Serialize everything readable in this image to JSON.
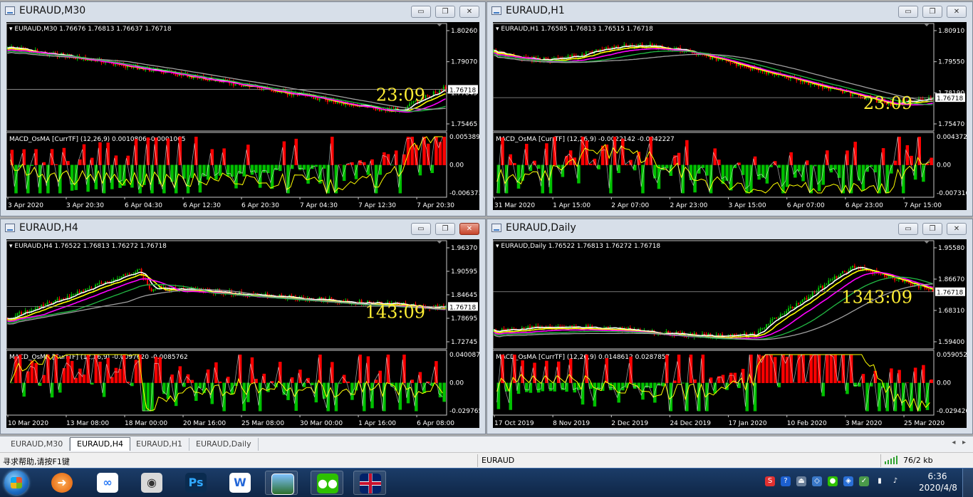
{
  "windows": [
    {
      "id": "m30",
      "title": "EURAUD,M30",
      "header": "EURAUD,M30  1.76676 1.76813 1.76637 1.76718",
      "price_ticks": [
        "1.80260",
        "1.79070",
        "1.77845",
        "1.75465"
      ],
      "current_price": "1.76718",
      "countdown": "23:09",
      "macd_header": "MACD_OsMA [CurrTF] (12,26,9) 0.0010806 -0.0001065",
      "macd_ticks": [
        "0.0053894",
        "0.00",
        "-0.006373"
      ],
      "time_labels": [
        "3 Apr 2020",
        "3 Apr 20:30",
        "6 Apr 04:30",
        "6 Apr 12:30",
        "6 Apr 20:30",
        "7 Apr 04:30",
        "7 Apr 12:30",
        "7 Apr 20:30"
      ]
    },
    {
      "id": "h1",
      "title": "EURAUD,H1",
      "header": "EURAUD,H1  1.76585 1.76813 1.76515 1.76718",
      "price_ticks": [
        "1.80910",
        "1.79550",
        "1.78190",
        "1.75470"
      ],
      "current_price": "1.76718",
      "countdown": "23:09",
      "macd_header": "MACD_OsMA [CurrTF] (12,26,9) -0.0022142 -0.0042227",
      "macd_ticks": [
        "0.0043724",
        "0.00",
        "-0.007316"
      ],
      "time_labels": [
        "31 Mar 2020",
        "1 Apr 15:00",
        "2 Apr 07:00",
        "2 Apr 23:00",
        "3 Apr 15:00",
        "6 Apr 07:00",
        "6 Apr 23:00",
        "7 Apr 15:00"
      ]
    },
    {
      "id": "h4",
      "title": "EURAUD,H4",
      "header": "EURAUD,H4  1.76522 1.76813 1.76272 1.76718",
      "price_ticks": [
        "1.96370",
        "1.90595",
        "1.84645",
        "1.78695",
        "1.72745"
      ],
      "current_price": "1.76718",
      "countdown": "143:09",
      "macd_header": "MACD_OsMA [CurrTF] (12,26,9) -0.0097620 -0.0085762",
      "macd_ticks": [
        "0.0400879",
        "0.00",
        "-0.029765"
      ],
      "time_labels": [
        "10 Mar 2020",
        "13 Mar 08:00",
        "18 Mar 00:00",
        "20 Mar 16:00",
        "25 Mar 08:00",
        "30 Mar 00:00",
        "1 Apr 16:00",
        "6 Apr 08:00"
      ]
    },
    {
      "id": "d1",
      "title": "EURAUD,Daily",
      "header": "EURAUD,Daily  1.76522 1.76813 1.76272 1.76718",
      "price_ticks": [
        "1.95580",
        "1.86670",
        "1.68310",
        "1.59400"
      ],
      "current_price": "1.76718",
      "countdown": "1343:09",
      "macd_header": "MACD_OsMA [CurrTF] (12,26,9) 0.0148612 0.0287857",
      "macd_ticks": [
        "0.0590525",
        "0.00",
        "-0.029420"
      ],
      "time_labels": [
        "17 Oct 2019",
        "8 Nov 2019",
        "2 Dec 2019",
        "24 Dec 2019",
        "17 Jan 2020",
        "10 Feb 2020",
        "3 Mar 2020",
        "25 Mar 2020"
      ]
    }
  ],
  "tabs": [
    "EURAUD,M30",
    "EURAUD,H4",
    "EURAUD,H1",
    "EURAUD,Daily"
  ],
  "active_tab": "EURAUD,H4",
  "statusbar": {
    "help": "寻求帮助,请按F1键",
    "symbol": "EURAUD",
    "traffic": "76/2 kb"
  },
  "clock": {
    "time": "6:36",
    "date": "2020/4/8"
  },
  "colors": {
    "candle_up": "#00c000",
    "candle_down": "#ff0000",
    "ma_fast": "#ffffff",
    "ma_2": "#ffff00",
    "ma_3": "#ff00ff",
    "ma_4": "#22bb44",
    "ma_5": "#a0a0a0",
    "countdown": "#ffee33"
  },
  "icons": [
    "windows-start-icon",
    "app-icon",
    "baidu-netdisk-icon",
    "camera-icon",
    "photoshop-icon",
    "wps-icon",
    "picture-viewer-icon",
    "wechat-icon",
    "metatrader-uk-flag-icon"
  ]
}
